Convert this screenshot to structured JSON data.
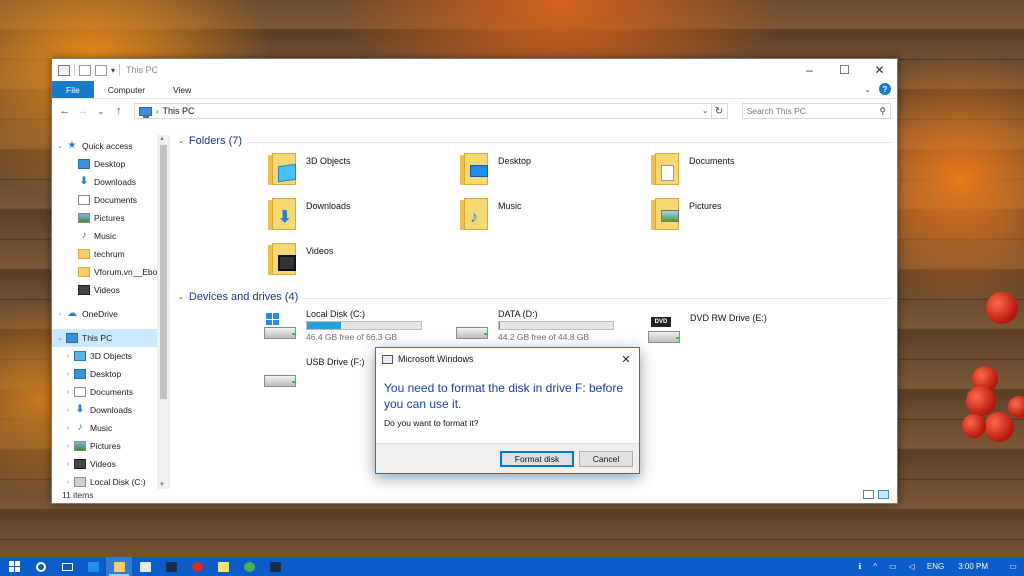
{
  "window": {
    "title": "This PC",
    "controls": {
      "minimize": "–",
      "maximize": "☐",
      "close": "✕"
    }
  },
  "ribbon": {
    "tabs": [
      "File",
      "Computer",
      "View"
    ],
    "expand_glyph": "⌄",
    "help_glyph": "?"
  },
  "navbar": {
    "back": "←",
    "forward": "→",
    "recent": "⌄",
    "up": "↑",
    "crumb_sep": "›",
    "path": "This PC",
    "refresh": "↻",
    "search_placeholder": "Search This PC",
    "search_glyph": "⚲"
  },
  "nav_pane": {
    "items": [
      {
        "label": "Quick access",
        "expander": "⌄",
        "icon": "star-icon"
      },
      {
        "label": "Desktop",
        "pinned": true,
        "icon": "desktop-icon"
      },
      {
        "label": "Downloads",
        "pinned": true,
        "icon": "downloads-icon"
      },
      {
        "label": "Documents",
        "pinned": true,
        "icon": "documents-icon"
      },
      {
        "label": "Pictures",
        "pinned": true,
        "icon": "pictures-icon"
      },
      {
        "label": "Music",
        "icon": "music-icon"
      },
      {
        "label": "techrum",
        "icon": "folder-icon"
      },
      {
        "label": "Vforum.vn__Ebo",
        "icon": "folder-icon"
      },
      {
        "label": "Videos",
        "icon": "videos-icon"
      },
      {
        "label": "OneDrive",
        "expander": "›",
        "icon": "onedrive-icon"
      },
      {
        "label": "This PC",
        "expander": "⌄",
        "icon": "this-pc-icon",
        "selected": true
      },
      {
        "label": "3D Objects",
        "expander": "›",
        "icon": "3d-objects-icon"
      },
      {
        "label": "Desktop",
        "expander": "›",
        "icon": "desktop-icon"
      },
      {
        "label": "Documents",
        "expander": "›",
        "icon": "documents-icon"
      },
      {
        "label": "Downloads",
        "expander": "›",
        "icon": "downloads-icon"
      },
      {
        "label": "Music",
        "expander": "›",
        "icon": "music-icon"
      },
      {
        "label": "Pictures",
        "expander": "›",
        "icon": "pictures-icon"
      },
      {
        "label": "Videos",
        "expander": "›",
        "icon": "videos-icon"
      },
      {
        "label": "Local Disk (C:)",
        "expander": "›",
        "icon": "local-disk-icon"
      }
    ],
    "pin_glyph": "📌"
  },
  "content": {
    "folders_header": "Folders (7)",
    "folders": [
      {
        "label": "3D Objects",
        "overlay": "3d-objects"
      },
      {
        "label": "Desktop",
        "overlay": "desktop"
      },
      {
        "label": "Documents",
        "overlay": "documents"
      },
      {
        "label": "Downloads",
        "overlay": "downloads"
      },
      {
        "label": "Music",
        "overlay": "music"
      },
      {
        "label": "Pictures",
        "overlay": "pictures"
      },
      {
        "label": "Videos",
        "overlay": "videos"
      }
    ],
    "devices_header": "Devices and drives (4)",
    "drives": [
      {
        "name": "Local Disk (C:)",
        "free": "46.4 GB free of 66.3 GB",
        "used_fraction": 0.3,
        "type": "system"
      },
      {
        "name": "DATA (D:)",
        "free": "44.2 GB free of 44.8 GB",
        "used_fraction": 0.013,
        "type": "data"
      },
      {
        "name": "DVD RW Drive (E:)",
        "type": "dvd",
        "dvd_label": "DVD"
      },
      {
        "name": "USB Drive (F:)",
        "type": "usb"
      }
    ],
    "group_chevron": "⌄"
  },
  "status": {
    "items": "11 items"
  },
  "dialog": {
    "title": "Microsoft Windows",
    "close": "✕",
    "message": "You need to format the disk in drive F: before you can use it.",
    "question": "Do you want to format it?",
    "primary_button": "Format disk",
    "cancel_button": "Cancel"
  },
  "taskbar": {
    "pinned": [
      {
        "name": "edge",
        "color": "#1e90e8"
      },
      {
        "name": "file-explorer",
        "color": "#f4cf6a",
        "active": true
      },
      {
        "name": "store",
        "color": "#e8e8e8"
      },
      {
        "name": "photoshop-1",
        "color": "#1b2a4a"
      },
      {
        "name": "app-red",
        "color": "#d42b2b"
      },
      {
        "name": "sticky-notes",
        "color": "#f6e36b"
      },
      {
        "name": "chrome",
        "color": "#4caf50"
      },
      {
        "name": "photoshop-2",
        "color": "#1b2a4a"
      }
    ],
    "tray": {
      "people": "ℹ",
      "chevron": "^",
      "language": "ENG",
      "time": "3:00 PM",
      "notification": "▭"
    }
  },
  "colors": {
    "accent": "#1979ca",
    "group_header": "#1e3287",
    "dialog_text": "#1a3fa3",
    "drive_bar": "#26a0da",
    "taskbar": "#0b5cc8"
  }
}
